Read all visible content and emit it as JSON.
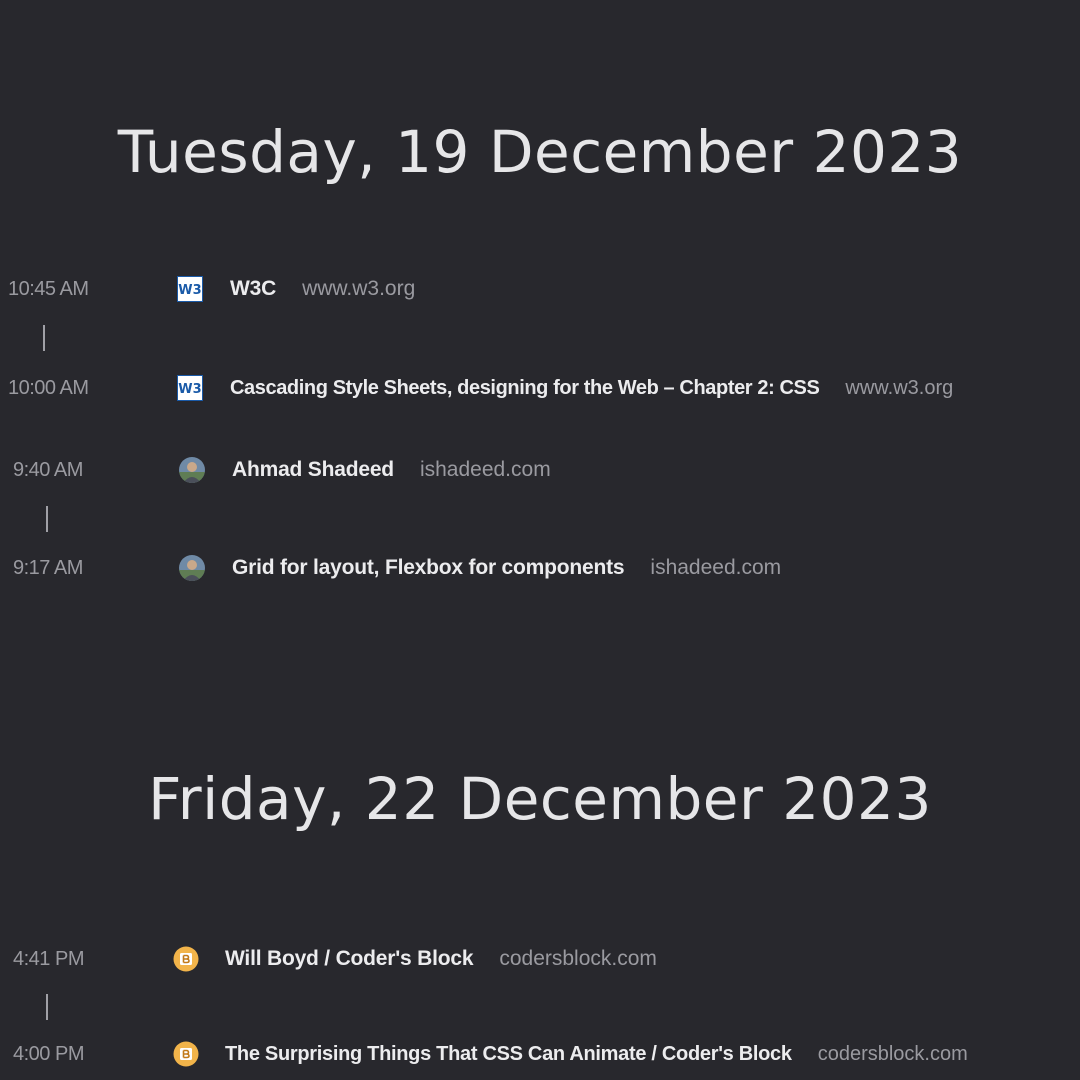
{
  "days": [
    {
      "heading": "Tuesday, 19 December 2023",
      "entries": [
        {
          "time": "10:45 AM",
          "icon": "w3c-logo-icon",
          "title": "W3C",
          "domain": "www.w3.org"
        },
        {
          "time": "10:00 AM",
          "icon": "w3c-logo-icon",
          "title": "Cascading Style Sheets, designing for the Web – Chapter 2: CSS",
          "domain": "www.w3.org"
        },
        {
          "time": "9:40 AM",
          "icon": "avatar-icon",
          "title": "Ahmad Shadeed",
          "domain": "ishadeed.com"
        },
        {
          "time": "9:17 AM",
          "icon": "avatar-icon",
          "title": "Grid for layout, Flexbox for components",
          "domain": "ishadeed.com"
        }
      ]
    },
    {
      "heading": "Friday, 22 December 2023",
      "entries": [
        {
          "time": "4:41 PM",
          "icon": "coders-block-icon",
          "title": "Will Boyd / Coder's Block",
          "domain": "codersblock.com"
        },
        {
          "time": "4:00 PM",
          "icon": "coders-block-icon",
          "title": "The Surprising Things That CSS Can Animate / Coder's Block",
          "domain": "codersblock.com"
        }
      ]
    }
  ],
  "colors": {
    "background": "#28282d",
    "heading": "#e6e6e8",
    "title": "#ececee",
    "muted": "#9a9aa0",
    "w3c_blue": "#1a5aa8"
  }
}
